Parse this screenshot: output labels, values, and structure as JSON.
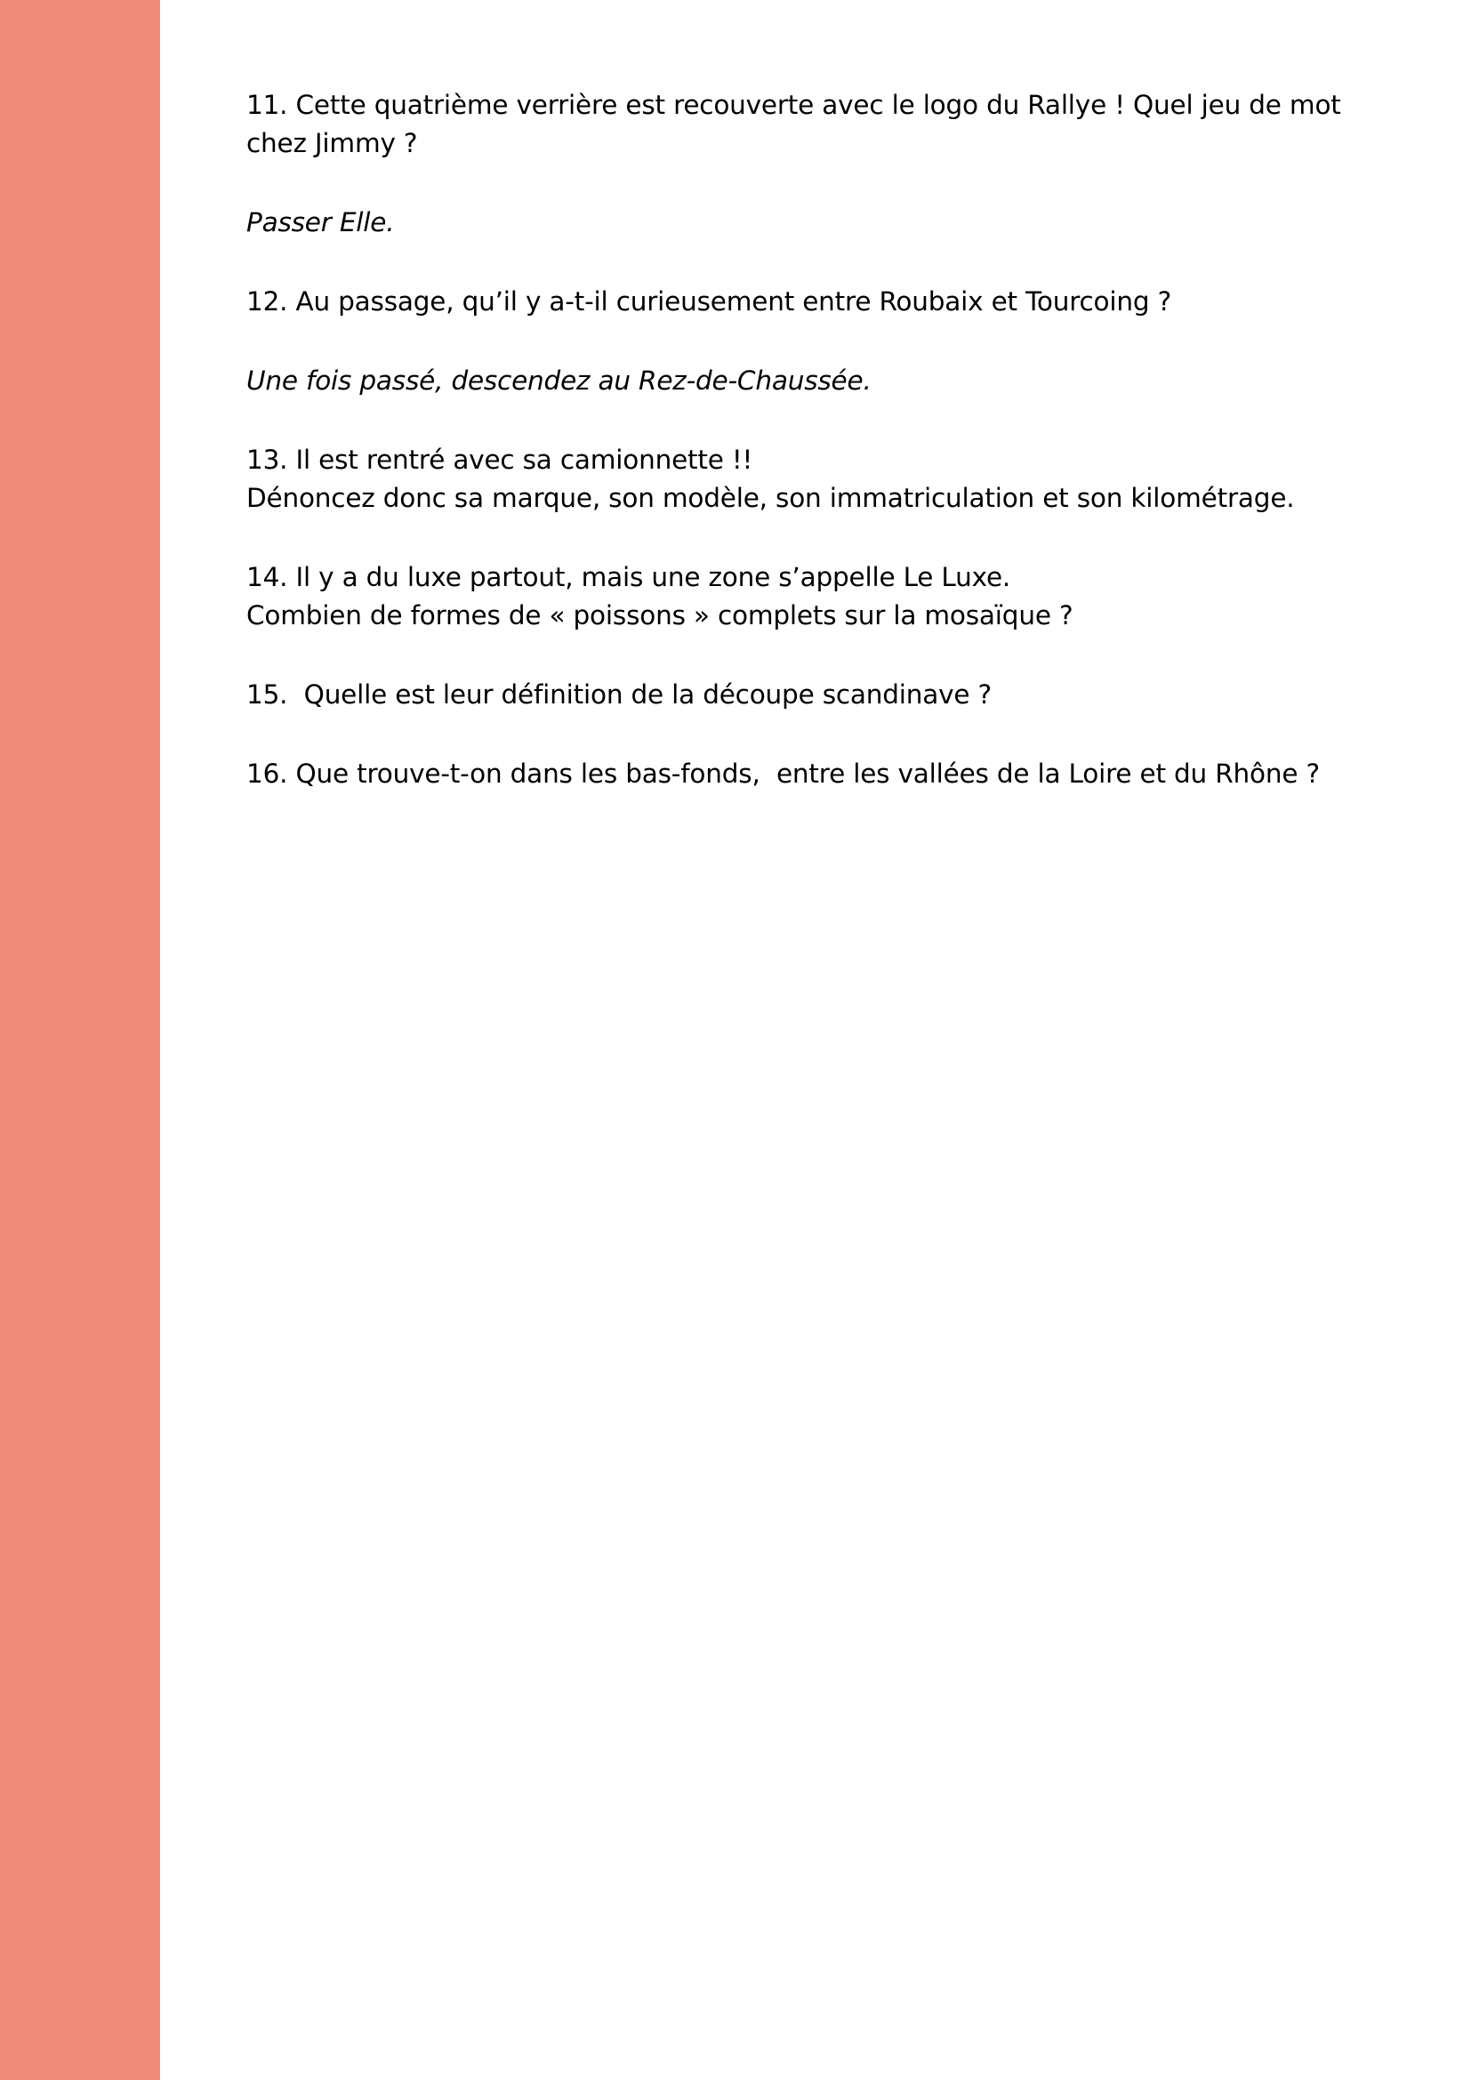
{
  "colors": {
    "side_band": "#ee8b79",
    "background": "#ffffff",
    "text": "#000000"
  },
  "questions": {
    "q11": {
      "line1": "11. Cette quatrième verrière est recouverte avec le logo du Rallye ! Quel jeu de mot",
      "line2": "chez Jimmy ?"
    },
    "note1": "Passer Elle.",
    "q12": "12. Au passage, qu’il y a-t-il curieusement entre Roubaix et Tourcoing ?",
    "note2": "Une fois passé, descendez au Rez-de-Chaussée.",
    "q13": {
      "line1": "13. Il est rentré avec sa camionnette !!",
      "line2": "Dénoncez donc sa marque, son modèle, son immatriculation et son kilométrage."
    },
    "q14": {
      "line1": "14. Il y a du luxe partout, mais une zone s’appelle Le Luxe.",
      "line2": "Combien de formes de « poissons » complets sur la mosaïque ?"
    },
    "q15": "15.  Quelle est leur définition de la découpe scandinave ?",
    "q16": "16. Que trouve-t-on dans les bas-fonds,  entre les vallées de la Loire et du Rhône ?"
  }
}
